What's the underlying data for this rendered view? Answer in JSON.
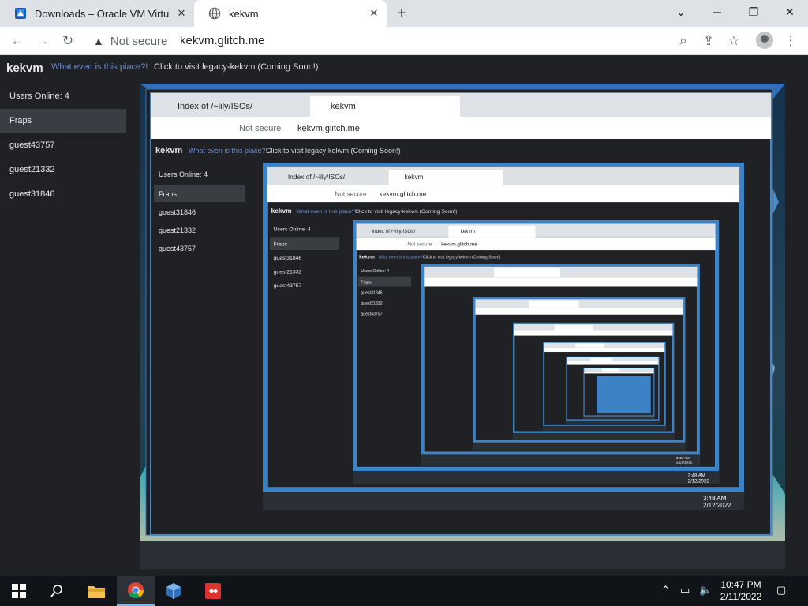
{
  "browser": {
    "tabs": [
      {
        "title": "Downloads – Oracle VM VirtualBox",
        "icon": "virtualbox-icon",
        "active": false
      },
      {
        "title": "kekvm",
        "icon": "globe-icon",
        "active": true
      }
    ],
    "security_label": "Not secure",
    "url": "kekvm.glitch.me"
  },
  "page": {
    "brand": "kekvm",
    "what_link": "What even is this place?!",
    "legacy_text": "Click to visit legacy-kekvm (Coming Soon!)",
    "sidebar": {
      "users_online": "Users Online: 4",
      "items": [
        "Fraps",
        "guest43757",
        "guest21332",
        "guest31846"
      ]
    },
    "vm": {
      "tabs": [
        "Index of /~lily/ISOs/",
        "kekvm"
      ],
      "security_label": "Not secure",
      "url": "kekvm.glitch.me",
      "brand": "kekvm",
      "what_link": "What even is this place?!",
      "legacy_text": "Click to visit legacy-kekvm (Coming Soon!)",
      "users_online": "Users Online: 4",
      "users": [
        "Fraps",
        "guest31846",
        "guest21332",
        "guest43757"
      ],
      "time": "3:48 AM",
      "date": "2/12/2022"
    }
  },
  "taskbar": {
    "time": "10:47 PM",
    "date": "2/11/2022"
  },
  "colors": {
    "accent": "#76b9ed",
    "page_bg": "#202124",
    "link": "#6f8fcf"
  }
}
